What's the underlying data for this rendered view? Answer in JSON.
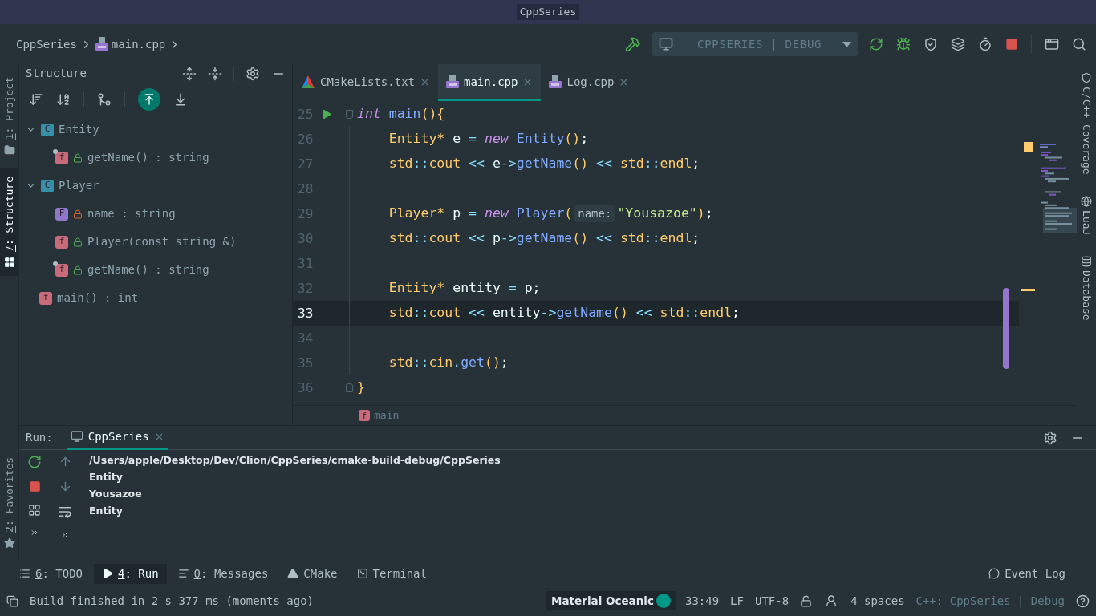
{
  "window": {
    "title": "CppSeries"
  },
  "breadcrumb": [
    {
      "label": "CppSeries",
      "kind": "project"
    },
    {
      "label": "main.cpp",
      "kind": "file"
    }
  ],
  "run_config": {
    "label": "CPPSERIES | DEBUG"
  },
  "left_strip": [
    {
      "key": "1",
      "label": ": Project",
      "kind": "project",
      "selected": false
    },
    {
      "key": "7",
      "label": ": Structure",
      "kind": "structure",
      "selected": true
    }
  ],
  "left_strip_bottom": [
    {
      "key": "2",
      "label": ": Favorites",
      "kind": "favorites",
      "selected": false
    }
  ],
  "right_strip": [
    {
      "label": "C/C++ Coverage",
      "kind": "coverage"
    },
    {
      "label": "LuaJ",
      "kind": "lua"
    },
    {
      "label": "Database",
      "kind": "database"
    }
  ],
  "structure": {
    "title": "Structure",
    "items": [
      {
        "badge": "C",
        "kind": "class",
        "label": "Entity",
        "expanded": true,
        "children": [
          {
            "badge": "f",
            "kind": "method",
            "private": false,
            "override": true,
            "label": "getName() : string"
          }
        ]
      },
      {
        "badge": "C",
        "kind": "class",
        "label": "Player",
        "expanded": true,
        "children": [
          {
            "badge": "F",
            "kind": "field",
            "private": true,
            "override": false,
            "label": "name : string"
          },
          {
            "badge": "f",
            "kind": "method",
            "private": false,
            "override": false,
            "label": "Player(const string &)"
          },
          {
            "badge": "f",
            "kind": "method",
            "private": false,
            "override": true,
            "label": "getName() : string"
          }
        ]
      },
      {
        "badge": "f",
        "kind": "function",
        "label": "main() : int"
      }
    ]
  },
  "editor": {
    "tabs": [
      {
        "label": "CMakeLists.txt",
        "kind": "cmake",
        "selected": false
      },
      {
        "label": "main.cpp",
        "kind": "cpp",
        "selected": true
      },
      {
        "label": "Log.cpp",
        "kind": "cpp",
        "selected": false
      }
    ],
    "lines": [
      {
        "number": "25",
        "kind": "fold-start",
        "run": true,
        "current": false,
        "tokens": [
          {
            "kind": "kw",
            "text": "int"
          },
          {
            "kind": "fn",
            "text": " main"
          },
          {
            "kind": "punc",
            "text": "(){"
          }
        ]
      },
      {
        "number": "26",
        "kind": "body",
        "run": false,
        "current": false,
        "tokens": [
          {
            "kind": "type",
            "text": "    Entity*"
          },
          {
            "kind": "plain",
            "text": " e "
          },
          {
            "kind": "op",
            "text": "="
          },
          {
            "kind": "kw",
            "text": " new"
          },
          {
            "kind": "fn",
            "text": " Entity"
          },
          {
            "kind": "punc",
            "text": "()"
          },
          {
            "kind": "plain",
            "text": ";"
          }
        ]
      },
      {
        "number": "27",
        "kind": "body",
        "run": false,
        "current": false,
        "tokens": [
          {
            "kind": "type",
            "text": "    std"
          },
          {
            "kind": "op",
            "text": "::"
          },
          {
            "kind": "type",
            "text": "cout"
          },
          {
            "kind": "op",
            "text": " <<"
          },
          {
            "kind": "plain",
            "text": " e"
          },
          {
            "kind": "op",
            "text": "->"
          },
          {
            "kind": "fn",
            "text": "getName"
          },
          {
            "kind": "punc",
            "text": "()"
          },
          {
            "kind": "op",
            "text": " <<"
          },
          {
            "kind": "type",
            "text": " std"
          },
          {
            "kind": "op",
            "text": "::"
          },
          {
            "kind": "type",
            "text": "endl"
          },
          {
            "kind": "plain",
            "text": ";"
          }
        ]
      },
      {
        "number": "28",
        "kind": "body",
        "run": false,
        "current": false
      },
      {
        "number": "29",
        "kind": "body",
        "run": false,
        "current": false,
        "tokens": [
          {
            "kind": "type",
            "text": "    Player*"
          },
          {
            "kind": "plain",
            "text": " p "
          },
          {
            "kind": "op",
            "text": "="
          },
          {
            "kind": "kw",
            "text": " new"
          },
          {
            "kind": "fn",
            "text": " Player"
          },
          {
            "kind": "punc",
            "text": "("
          },
          {
            "kind": "hint",
            "text": "name:"
          },
          {
            "kind": "str",
            "text": "\"Yousazoe\""
          },
          {
            "kind": "punc",
            "text": ")"
          },
          {
            "kind": "plain",
            "text": ";"
          }
        ]
      },
      {
        "number": "30",
        "kind": "body",
        "run": false,
        "current": false,
        "tokens": [
          {
            "kind": "type",
            "text": "    std"
          },
          {
            "kind": "op",
            "text": "::"
          },
          {
            "kind": "type",
            "text": "cout"
          },
          {
            "kind": "op",
            "text": " <<"
          },
          {
            "kind": "plain",
            "text": " p"
          },
          {
            "kind": "op",
            "text": "->"
          },
          {
            "kind": "fn",
            "text": "getName"
          },
          {
            "kind": "punc",
            "text": "()"
          },
          {
            "kind": "op",
            "text": " <<"
          },
          {
            "kind": "type",
            "text": " std"
          },
          {
            "kind": "op",
            "text": "::"
          },
          {
            "kind": "type",
            "text": "endl"
          },
          {
            "kind": "plain",
            "text": ";"
          }
        ]
      },
      {
        "number": "31",
        "kind": "body",
        "run": false,
        "current": false
      },
      {
        "number": "32",
        "kind": "body",
        "run": false,
        "current": false,
        "tokens": [
          {
            "kind": "type",
            "text": "    Entity*"
          },
          {
            "kind": "plain",
            "text": " entity "
          },
          {
            "kind": "op",
            "text": "="
          },
          {
            "kind": "plain",
            "text": " p;"
          }
        ]
      },
      {
        "number": "33",
        "kind": "body",
        "run": false,
        "current": true,
        "tokens": [
          {
            "kind": "type",
            "text": "    std"
          },
          {
            "kind": "op",
            "text": "::"
          },
          {
            "kind": "type",
            "text": "cout"
          },
          {
            "kind": "op",
            "text": " <<"
          },
          {
            "kind": "plain",
            "text": " entity"
          },
          {
            "kind": "op",
            "text": "->"
          },
          {
            "kind": "fn",
            "text": "getName"
          },
          {
            "kind": "punc",
            "text": "()"
          },
          {
            "kind": "op",
            "text": " <<"
          },
          {
            "kind": "type",
            "text": " std"
          },
          {
            "kind": "op",
            "text": "::"
          },
          {
            "kind": "type",
            "text": "endl"
          },
          {
            "kind": "plain",
            "text": ";"
          }
        ]
      },
      {
        "number": "34",
        "kind": "body",
        "run": false,
        "current": false
      },
      {
        "number": "35",
        "kind": "body",
        "run": false,
        "current": false,
        "tokens": [
          {
            "kind": "type",
            "text": "    std"
          },
          {
            "kind": "op",
            "text": "::"
          },
          {
            "kind": "type",
            "text": "cin"
          },
          {
            "kind": "op",
            "text": "."
          },
          {
            "kind": "fn",
            "text": "get"
          },
          {
            "kind": "punc",
            "text": "()"
          },
          {
            "kind": "plain",
            "text": ";"
          }
        ]
      },
      {
        "number": "36",
        "kind": "fold-end",
        "run": false,
        "current": false,
        "tokens": [
          {
            "kind": "punc",
            "text": "}"
          }
        ]
      }
    ],
    "breadcrumb": {
      "badge": "f",
      "label": "main"
    }
  },
  "run_panel": {
    "title": "Run:",
    "tab": {
      "label": "CppSeries",
      "selected": true
    },
    "output": [
      "/Users/apple/Desktop/Dev/Clion/CppSeries/cmake-build-debug/CppSeries",
      "Entity",
      "Yousazoe",
      "Entity"
    ]
  },
  "tool_tabs": [
    {
      "kind": "todo",
      "key": "6",
      "label": ": TODO",
      "selected": false
    },
    {
      "kind": "run",
      "key": "4",
      "label": ": Run",
      "selected": true
    },
    {
      "kind": "messages",
      "key": "0",
      "label": ": Messages",
      "selected": false
    },
    {
      "kind": "cmake",
      "label": "CMake",
      "selected": false
    },
    {
      "kind": "terminal",
      "label": "Terminal",
      "selected": false
    },
    {
      "kind": "event-log",
      "label": "Event Log",
      "selected": false
    }
  ],
  "status_bar": {
    "message": "Build finished in 2 s 377 ms (moments ago)",
    "theme": "Material Oceanic",
    "position": "33:49",
    "line_ending": "LF",
    "encoding": "UTF-8",
    "indent": "4 spaces",
    "context": "C++: CppSeries | Debug"
  }
}
